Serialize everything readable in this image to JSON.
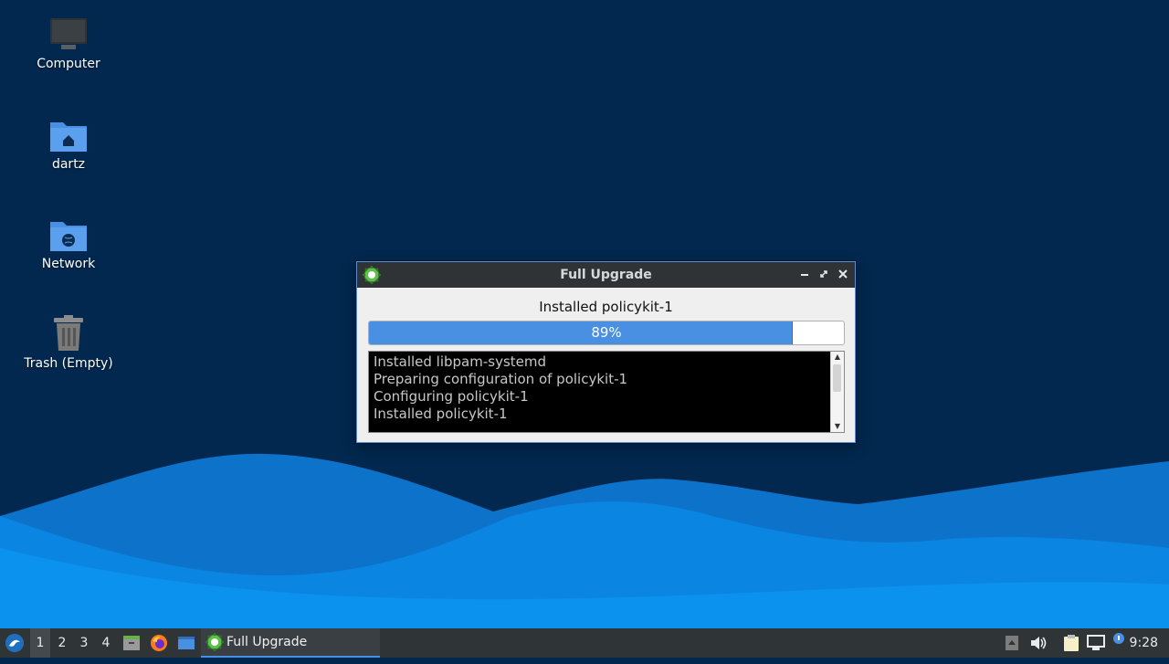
{
  "desktop": {
    "icons": [
      {
        "label": "Computer"
      },
      {
        "label": "dartz"
      },
      {
        "label": "Network"
      },
      {
        "label": "Trash (Empty)"
      }
    ]
  },
  "dialog": {
    "title": "Full Upgrade",
    "status": "Installed policykit-1",
    "progress_value": 0.89,
    "progress_text": "89%",
    "log_lines": [
      "Installed libpam-systemd",
      "Preparing configuration of policykit-1",
      "Configuring policykit-1",
      "Installed policykit-1"
    ]
  },
  "taskbar": {
    "workspaces": [
      "1",
      "2",
      "3",
      "4"
    ],
    "active_workspace": "1",
    "task_label": "Full Upgrade",
    "clock": "9:28"
  },
  "colors": {
    "desktop_bg": "#02284f",
    "accent": "#4a90e2",
    "taskbar_bg": "#2f3437"
  }
}
